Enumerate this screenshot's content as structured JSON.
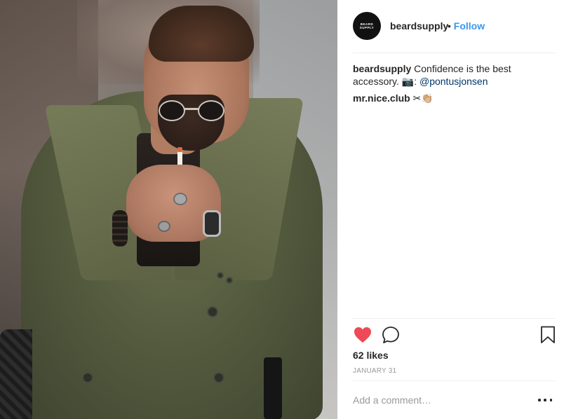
{
  "post": {
    "image_alt": "",
    "author": {
      "username": "beardsupply",
      "avatar_lines": [
        "BEARD",
        "SUPPLY"
      ],
      "separator": "•",
      "follow_label": "Follow"
    },
    "caption": {
      "username": "beardsupply",
      "text": " Confidence is the best accessory. ",
      "camera_emoji": "📷",
      "colon": ": ",
      "mention": "@pontusjonsen"
    },
    "caption_2": {
      "username": "mr.nice.club",
      "emoji": " ✂👏🏼"
    },
    "likes_text": "62 likes",
    "date_text": "JANUARY 31",
    "comment_placeholder": "Add a comment…"
  },
  "icons": {
    "like": "heart-filled-icon",
    "comment": "comment-bubble-icon",
    "save": "bookmark-icon",
    "more": "more-options-icon"
  },
  "colors": {
    "like_red": "#ed4956",
    "follow_blue": "#3897f0",
    "mention_blue": "#003569",
    "muted_gray": "#999999",
    "text": "#262626"
  }
}
